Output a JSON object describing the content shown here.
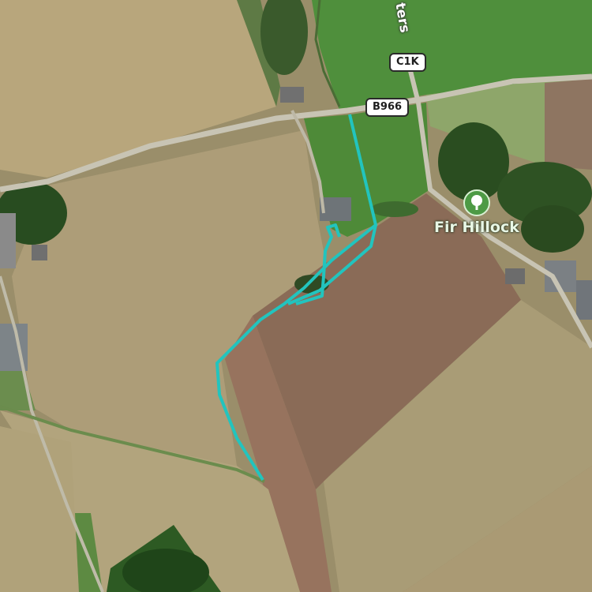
{
  "map": {
    "type": "satellite",
    "route_color": "#22c4be"
  },
  "roads": {
    "b966": "B966",
    "c1k": "C1K",
    "partial_street": "ters"
  },
  "places": {
    "fir_hillock": "Fir Hillock"
  },
  "icons": {
    "poi": "tree-icon"
  }
}
